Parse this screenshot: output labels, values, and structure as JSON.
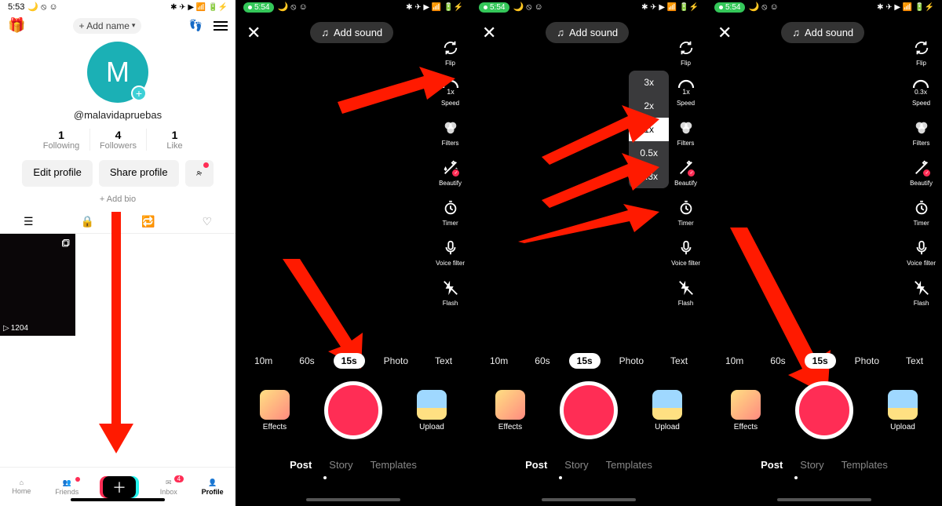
{
  "status": {
    "time_profile": "5:53",
    "time_cam": "5:54",
    "icons_left": "🌙 ⦸ ☺",
    "icons_right": "✱ ✈ ▶ 📶 🔋⚡"
  },
  "profile": {
    "add_name": "+ Add name",
    "avatar_letter": "M",
    "handle": "@malavidapruebas",
    "stats": [
      {
        "n": "1",
        "l": "Following"
      },
      {
        "n": "4",
        "l": "Followers"
      },
      {
        "n": "1",
        "l": "Like"
      }
    ],
    "edit": "Edit profile",
    "share": "Share profile",
    "add_bio": "+ Add bio",
    "views": "1204",
    "tabs": {
      "home": "Home",
      "friends": "Friends",
      "inbox": "Inbox",
      "profile": "Profile",
      "inbox_badge": "4"
    }
  },
  "camera": {
    "add_sound": "Add sound",
    "tools": {
      "flip": "Flip",
      "speed": "Speed",
      "filters": "Filters",
      "beautify": "Beautify",
      "timer": "Timer",
      "voice": "Voice filter",
      "flash": "Flash",
      "speed_1x": "1x",
      "speed_03x": "0.3x"
    },
    "speed_options": [
      "3x",
      "2x",
      "1x",
      "0.5x",
      "0.3x"
    ],
    "speed_selected": "1x",
    "durations": [
      "10m",
      "60s",
      "15s",
      "Photo",
      "Text"
    ],
    "duration_selected": "15s",
    "effects": "Effects",
    "upload": "Upload",
    "modes": {
      "post": "Post",
      "story": "Story",
      "templates": "Templates"
    }
  }
}
